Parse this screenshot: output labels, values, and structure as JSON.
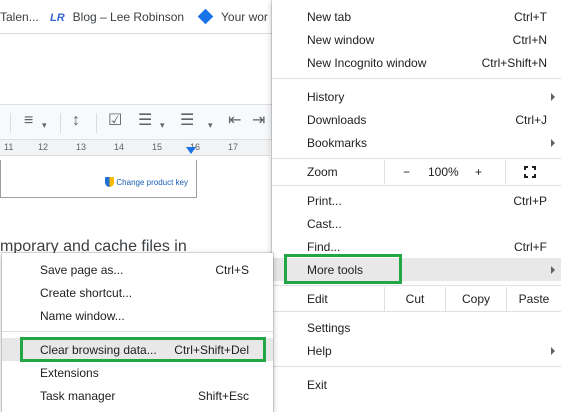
{
  "bookmarks_bar": {
    "items": [
      {
        "label": "Talen..."
      },
      {
        "icon_text": "LR",
        "label": "Blog – Lee Robinson"
      },
      {
        "label": "Your wor"
      }
    ]
  },
  "ruler": {
    "ticks": [
      "11",
      "12",
      "13",
      "14",
      "15",
      "16",
      "17"
    ]
  },
  "windows_popup": {
    "link": "Change product key"
  },
  "page_text": {
    "fragment": "mporary and cache files in"
  },
  "main_menu": {
    "new_tab": {
      "label": "New tab",
      "shortcut": "Ctrl+T"
    },
    "new_window": {
      "label": "New window",
      "shortcut": "Ctrl+N"
    },
    "new_incognito": {
      "label": "New Incognito window",
      "shortcut": "Ctrl+Shift+N"
    },
    "history": {
      "label": "History"
    },
    "downloads": {
      "label": "Downloads",
      "shortcut": "Ctrl+J"
    },
    "bookmarks": {
      "label": "Bookmarks"
    },
    "zoom": {
      "label": "Zoom",
      "minus": "−",
      "value": "100%",
      "plus": "+"
    },
    "print": {
      "label": "Print...",
      "shortcut": "Ctrl+P"
    },
    "cast": {
      "label": "Cast..."
    },
    "find": {
      "label": "Find...",
      "shortcut": "Ctrl+F"
    },
    "more_tools": {
      "label": "More tools"
    },
    "edit": {
      "label": "Edit",
      "cut": "Cut",
      "copy": "Copy",
      "paste": "Paste"
    },
    "settings": {
      "label": "Settings"
    },
    "help": {
      "label": "Help"
    },
    "exit": {
      "label": "Exit"
    }
  },
  "more_tools_menu": {
    "save_page": {
      "label": "Save page as...",
      "shortcut": "Ctrl+S"
    },
    "create_shortcut": {
      "label": "Create shortcut..."
    },
    "name_window": {
      "label": "Name window..."
    },
    "clear_browsing": {
      "label": "Clear browsing data...",
      "shortcut": "Ctrl+Shift+Del"
    },
    "extensions": {
      "label": "Extensions"
    },
    "task_manager": {
      "label": "Task manager",
      "shortcut": "Shift+Esc"
    }
  },
  "colors": {
    "annotation": "#22a744",
    "highlight": "#e8e8e8"
  }
}
